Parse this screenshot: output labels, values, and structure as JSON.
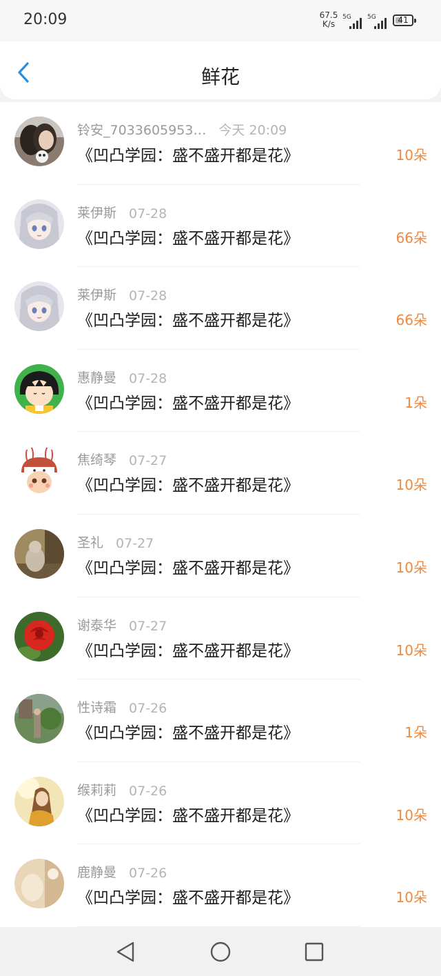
{
  "status_bar": {
    "time": "20:09",
    "net_speed_value": "67.5",
    "net_speed_unit": "K/s",
    "sim1_tag": "5G",
    "sim2_tag": "5G",
    "battery": "41"
  },
  "header": {
    "back_icon": "chevron-left-icon",
    "title": "鲜花",
    "accent_color": "#2a8fe0"
  },
  "colors": {
    "count": "#f0893c"
  },
  "items": [
    {
      "sender": "铃安_7033605953…",
      "date": "今天 20:09",
      "book": "《凹凸学园：盛不盛开都是花》",
      "count": "10朵",
      "avatar": "girl-photo"
    },
    {
      "sender": "莱伊斯",
      "date": "07-28",
      "book": "《凹凸学园：盛不盛开都是花》",
      "count": "66朵",
      "avatar": "anime-white-hair"
    },
    {
      "sender": "莱伊斯",
      "date": "07-28",
      "book": "《凹凸学园：盛不盛开都是花》",
      "count": "66朵",
      "avatar": "anime-white-hair"
    },
    {
      "sender": "惠静曼",
      "date": "07-28",
      "book": "《凹凸学园：盛不盛开都是花》",
      "count": "1朵",
      "avatar": "cartoon-girl"
    },
    {
      "sender": "焦绮琴",
      "date": "07-27",
      "book": "《凹凸学园：盛不盛开都是花》",
      "count": "10朵",
      "avatar": "bunny-hat"
    },
    {
      "sender": "圣礼",
      "date": "07-27",
      "book": "《凹凸学园：盛不盛开都是花》",
      "count": "10朵",
      "avatar": "cat-photo"
    },
    {
      "sender": "谢泰华",
      "date": "07-27",
      "book": "《凹凸学园：盛不盛开都是花》",
      "count": "10朵",
      "avatar": "red-rose"
    },
    {
      "sender": "性诗霜",
      "date": "07-26",
      "book": "《凹凸学园：盛不盛开都是花》",
      "count": "1朵",
      "avatar": "garden-photo"
    },
    {
      "sender": "缑莉莉",
      "date": "07-26",
      "book": "《凹凸学园：盛不盛开都是花》",
      "count": "10朵",
      "avatar": "girl-painting"
    },
    {
      "sender": "鹿静曼",
      "date": "07-26",
      "book": "《凹凸学园：盛不盛开都是花》",
      "count": "10朵",
      "avatar": "soft-photo"
    }
  ],
  "nav_bar": {
    "back": "triangle-back-icon",
    "home": "circle-home-icon",
    "recents": "square-recents-icon"
  }
}
